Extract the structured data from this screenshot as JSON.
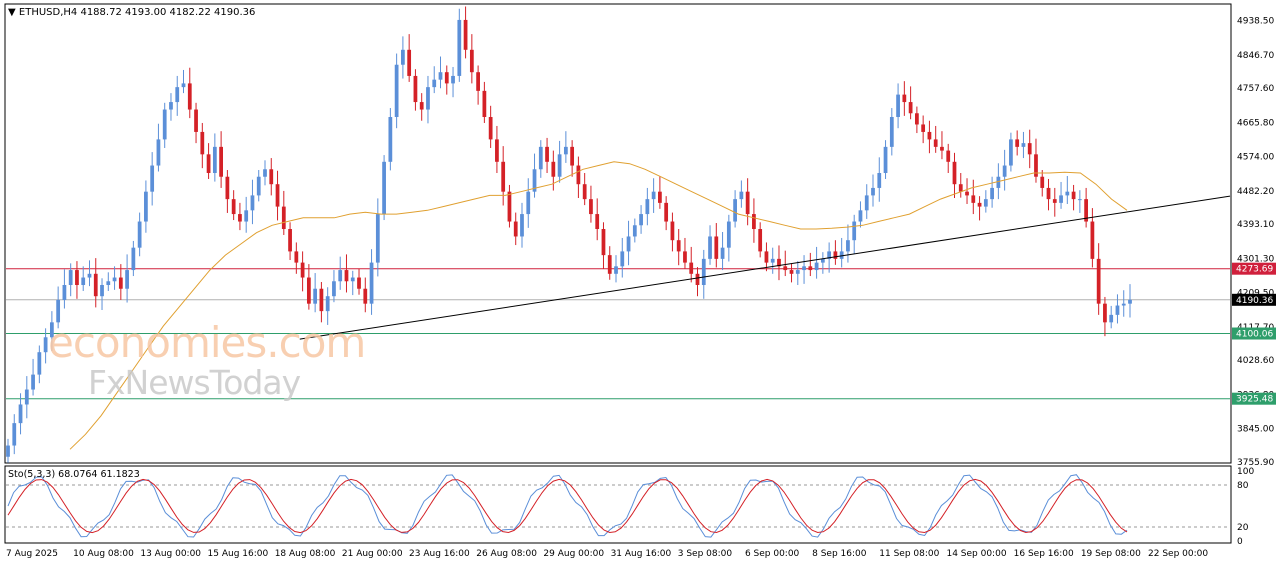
{
  "header": {
    "triangle_glyph": "▼",
    "symbol_text": "ETHUSD,H4",
    "ohlc_text": "4188.72 4193.00 4182.22 4190.36"
  },
  "watermark": {
    "line1": "economies.com",
    "line2": "FxNewsToday"
  },
  "chart_data": [
    {
      "type": "candlestick",
      "ylim": [
        3755.9,
        4980
      ],
      "y_ticks": [
        4938.5,
        4846.7,
        4757.6,
        4665.8,
        4574.0,
        4482.2,
        4393.1,
        4301.3,
        4209.5,
        4117.7,
        4028.6,
        3936.8,
        3845.0,
        3755.9
      ],
      "y_tick_labels": [
        "4938.50",
        "4846.70",
        "4757.60",
        "4665.80",
        "4574.00",
        "4482.20",
        "4393.10",
        "4301.30",
        "4209.50",
        "4117.70",
        "4028.60",
        "3936.80",
        "3845.00",
        "3755.90"
      ],
      "x_labels": [
        "7 Aug 2025",
        "10 Aug 08:00",
        "13 Aug 00:00",
        "15 Aug 16:00",
        "18 Aug 08:00",
        "21 Aug 00:00",
        "23 Aug 16:00",
        "26 Aug 08:00",
        "29 Aug 00:00",
        "31 Aug 16:00",
        "3 Sep 08:00",
        "6 Sep 00:00",
        "8 Sep 16:00",
        "11 Sep 08:00",
        "14 Sep 00:00",
        "16 Sep 16:00",
        "19 Sep 08:00",
        "22 Sep 00:00"
      ],
      "closes": [
        3800,
        3860,
        3910,
        3950,
        3990,
        4050,
        4090,
        4130,
        4190,
        4230,
        4270,
        4230,
        4250,
        4260,
        4200,
        4230,
        4240,
        4250,
        4220,
        4270,
        4330,
        4400,
        4480,
        4550,
        4620,
        4700,
        4720,
        4760,
        4770,
        4700,
        4640,
        4580,
        4530,
        4600,
        4520,
        4460,
        4420,
        4400,
        4430,
        4470,
        4520,
        4540,
        4500,
        4440,
        4380,
        4320,
        4290,
        4250,
        4180,
        4220,
        4160,
        4200,
        4240,
        4270,
        4240,
        4250,
        4220,
        4180,
        4290,
        4420,
        4560,
        4680,
        4820,
        4860,
        4790,
        4720,
        4700,
        4760,
        4780,
        4800,
        4770,
        4790,
        4940,
        4860,
        4800,
        4750,
        4680,
        4620,
        4560,
        4480,
        4400,
        4360,
        4420,
        4480,
        4540,
        4600,
        4560,
        4520,
        4580,
        4600,
        4550,
        4500,
        4460,
        4420,
        4380,
        4310,
        4260,
        4280,
        4320,
        4360,
        4390,
        4420,
        4460,
        4480,
        4450,
        4400,
        4350,
        4320,
        4290,
        4260,
        4230,
        4300,
        4360,
        4300,
        4330,
        4400,
        4460,
        4480,
        4420,
        4380,
        4320,
        4290,
        4300,
        4280,
        4270,
        4260,
        4270,
        4280,
        4270,
        4290,
        4300,
        4320,
        4300,
        4320,
        4350,
        4400,
        4430,
        4470,
        4490,
        4530,
        4600,
        4680,
        4740,
        4720,
        4690,
        4660,
        4640,
        4620,
        4600,
        4590,
        4560,
        4500,
        4480,
        4470,
        4450,
        4440,
        4460,
        4490,
        4520,
        4550,
        4620,
        4600,
        4610,
        4580,
        4520,
        4490,
        4460,
        4450,
        4470,
        4480,
        4460,
        4460,
        4400,
        4300,
        4180,
        4130,
        4150,
        4175,
        4180,
        4190.36
      ],
      "ma_values": [
        3790,
        3830,
        3880,
        3940,
        4000,
        4060,
        4120,
        4170,
        4220,
        4270,
        4310,
        4340,
        4370,
        4390,
        4400,
        4410,
        4410,
        4410,
        4420,
        4425,
        4420,
        4420,
        4425,
        4430,
        4440,
        4450,
        4460,
        4470,
        4470,
        4480,
        4490,
        4500,
        4520,
        4540,
        4550,
        4560,
        4555,
        4540,
        4520,
        4500,
        4480,
        4460,
        4440,
        4420,
        4410,
        4400,
        4390,
        4380,
        4380,
        4382,
        4385,
        4390,
        4400,
        4410,
        4420,
        4440,
        4460,
        4475,
        4490,
        4500,
        4510,
        4520,
        4530,
        4530,
        4532,
        4530,
        4500,
        4460,
        4430
      ],
      "stoch": {
        "label": "Sto(5,3,3) 68.0764 61.1823",
        "ylim": [
          0,
          100
        ],
        "levels": [
          20,
          80
        ],
        "y_tick_labels": [
          "100",
          "80",
          "20",
          "0"
        ]
      },
      "lines": [
        {
          "name": "support",
          "value": 4100.06,
          "label": "4100.06",
          "color": "#2e9e6b"
        },
        {
          "name": "support2",
          "value": 3925.48,
          "label": "3925.48",
          "color": "#2e9e6b"
        },
        {
          "name": "resistance",
          "value": 4273.69,
          "label": "4273.69",
          "color": "#d0203c"
        },
        {
          "name": "current",
          "value": 4190.36,
          "label": "4190.36",
          "color": "#000000"
        }
      ],
      "trendline": {
        "from": [
          0.24,
          4085
        ],
        "to": [
          1.0,
          4468
        ]
      }
    }
  ],
  "colors": {
    "bull": "#5b8fd8",
    "bear": "#d42127",
    "ma": "#e0a030",
    "stoch_k": "#5b8fd8",
    "stoch_d": "#d42127"
  }
}
